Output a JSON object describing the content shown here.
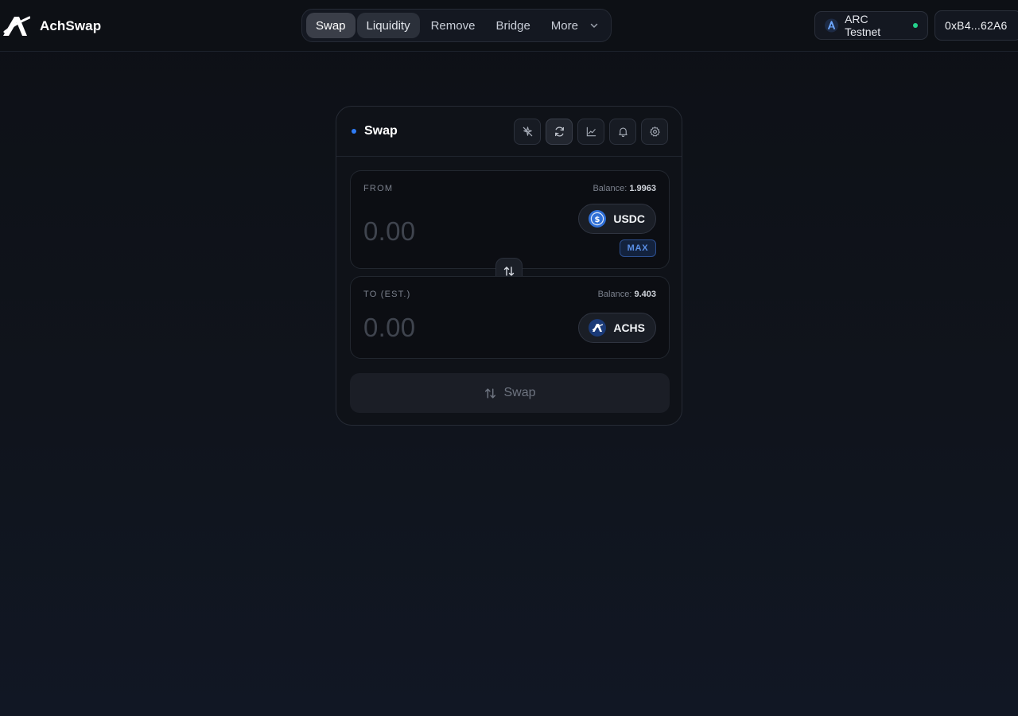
{
  "brand": {
    "name": "AchSwap",
    "logo_icon": "achswap-logo-icon"
  },
  "nav": {
    "items": [
      {
        "label": "Swap",
        "state": "active"
      },
      {
        "label": "Liquidity",
        "state": "hover"
      },
      {
        "label": "Remove",
        "state": "default"
      },
      {
        "label": "Bridge",
        "state": "default"
      },
      {
        "label": "More",
        "state": "default",
        "icon": "chevron-down-icon"
      }
    ]
  },
  "network": {
    "label": "ARC Testnet",
    "icon": "arc-network-icon",
    "status_color": "#23d18b"
  },
  "wallet": {
    "address": "0xB4...62A6"
  },
  "swap_card": {
    "title": "Swap",
    "title_dot_color": "#2f7cf6",
    "tools": [
      "sparkle-off-icon",
      "refresh-icon",
      "chart-icon",
      "bell-icon",
      "gear-icon"
    ],
    "from": {
      "label": "FROM",
      "balance_label": "Balance:",
      "balance_value": "1.9963",
      "amount_placeholder": "0.00",
      "token": {
        "symbol": "USDC",
        "icon": "usdc-token-icon"
      },
      "max_label": "MAX"
    },
    "to": {
      "label": "TO (EST.)",
      "balance_label": "Balance:",
      "balance_value": "9.403",
      "amount_placeholder": "0.00",
      "token": {
        "symbol": "ACHS",
        "icon": "achs-token-icon"
      }
    },
    "flip_icon": "swap-vertical-icon",
    "submit": {
      "label": "Swap",
      "icon": "swap-vertical-icon",
      "disabled": true
    }
  },
  "colors": {
    "background": "#0e1117",
    "accent": "#2f7cf6",
    "max_text": "#5a8fe6"
  }
}
